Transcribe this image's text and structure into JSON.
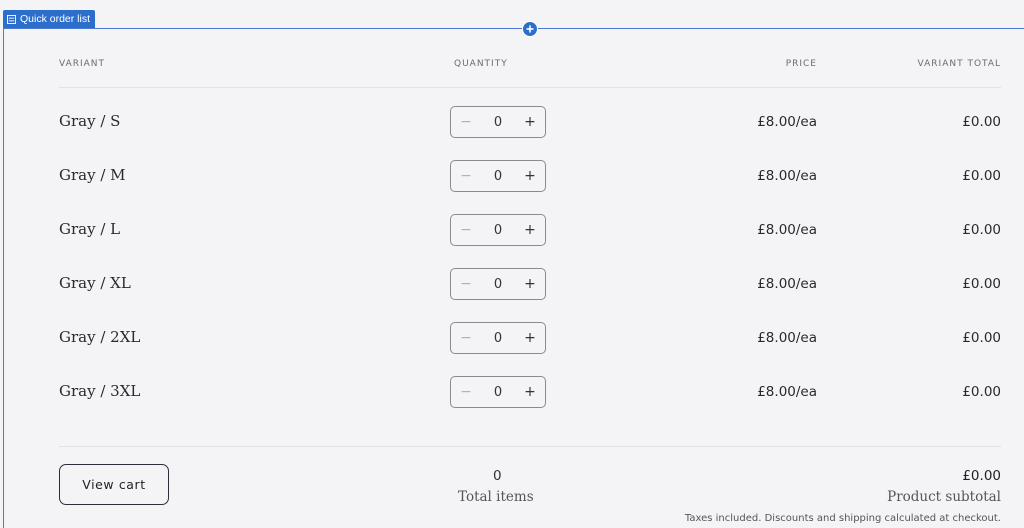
{
  "editor": {
    "section_tag": "Quick order list",
    "add_icon": "plus-icon"
  },
  "table": {
    "headers": {
      "variant": "VARIANT",
      "quantity": "QUANTITY",
      "price": "PRICE",
      "total": "VARIANT TOTAL"
    },
    "stepper": {
      "minus": "−",
      "plus": "+"
    },
    "rows": [
      {
        "variant": "Gray / S",
        "quantity": "0",
        "price": "£8.00/ea",
        "total": "£0.00"
      },
      {
        "variant": "Gray / M",
        "quantity": "0",
        "price": "£8.00/ea",
        "total": "£0.00"
      },
      {
        "variant": "Gray / L",
        "quantity": "0",
        "price": "£8.00/ea",
        "total": "£0.00"
      },
      {
        "variant": "Gray / XL",
        "quantity": "0",
        "price": "£8.00/ea",
        "total": "£0.00"
      },
      {
        "variant": "Gray / 2XL",
        "quantity": "0",
        "price": "£8.00/ea",
        "total": "£0.00"
      },
      {
        "variant": "Gray / 3XL",
        "quantity": "0",
        "price": "£8.00/ea",
        "total": "£0.00"
      }
    ]
  },
  "footer": {
    "view_cart": "View cart",
    "total_items_value": "0",
    "total_items_label": "Total items",
    "subtotal_value": "£0.00",
    "subtotal_label": "Product subtotal",
    "tax_note": "Taxes included. Discounts and shipping calculated at checkout."
  },
  "colors": {
    "editor_accent": "#2c6ecb",
    "background": "#f4f4f6"
  }
}
